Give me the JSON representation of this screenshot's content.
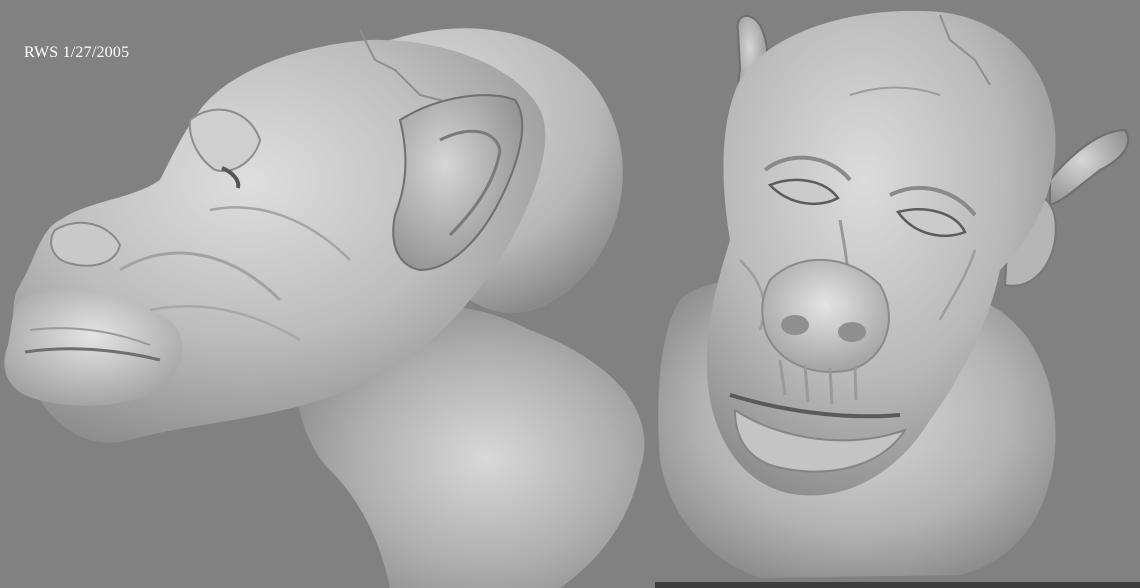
{
  "image": {
    "kind": "3d-sculpt-render",
    "signature": "RWS 1/27/2005",
    "background_color": "#818181",
    "surface_color": "#b9b9b9",
    "views": [
      {
        "name": "side-view",
        "subject": "creature-head-profile"
      },
      {
        "name": "front-view",
        "subject": "creature-head-front"
      }
    ]
  }
}
